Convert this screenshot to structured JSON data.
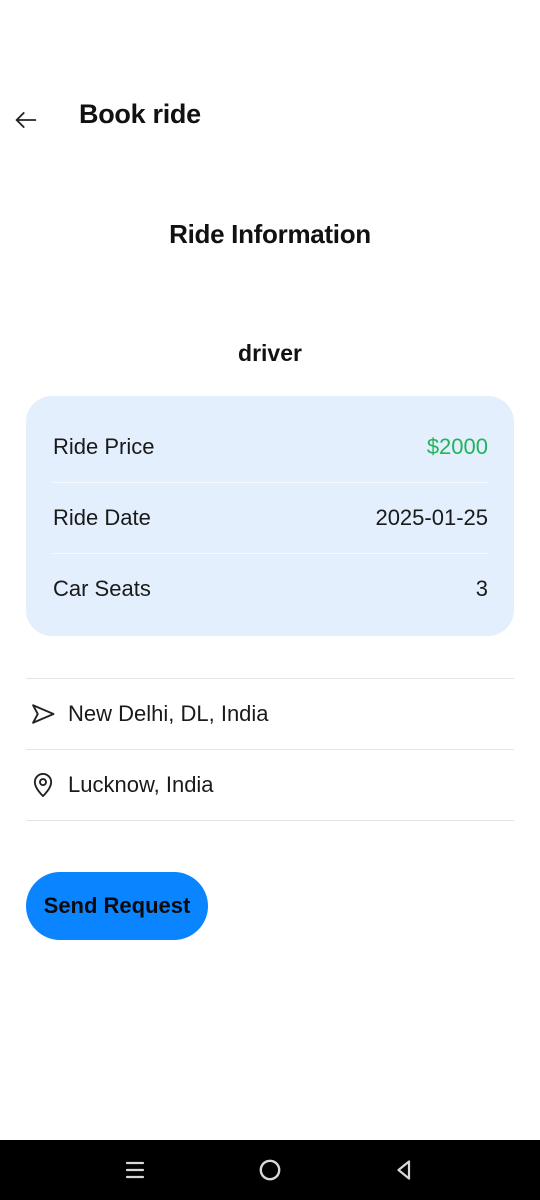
{
  "header": {
    "back_icon": "arrow-left-icon",
    "title": "Book ride"
  },
  "ride": {
    "section_title": "Ride Information",
    "driver_name": "driver",
    "details": [
      {
        "label": "Ride Price",
        "value": "$2000"
      },
      {
        "label": "Ride Date",
        "value": "2025-01-25"
      },
      {
        "label": "Car Seats",
        "value": "3"
      }
    ],
    "price_color": "#22b45a",
    "card_color": "#e3effd"
  },
  "locations": {
    "pickup": {
      "icon": "navigation-arrow-icon",
      "text": "New Delhi, DL, India"
    },
    "dropoff": {
      "icon": "map-pin-icon",
      "text": "Lucknow, India"
    }
  },
  "actions": {
    "send_request_label": "Send Request",
    "accent_color": "#0a84ff"
  },
  "system_nav": {
    "recents_icon": "menu-lines-icon",
    "home_icon": "circle-home-icon",
    "back_icon": "triangle-back-icon"
  }
}
